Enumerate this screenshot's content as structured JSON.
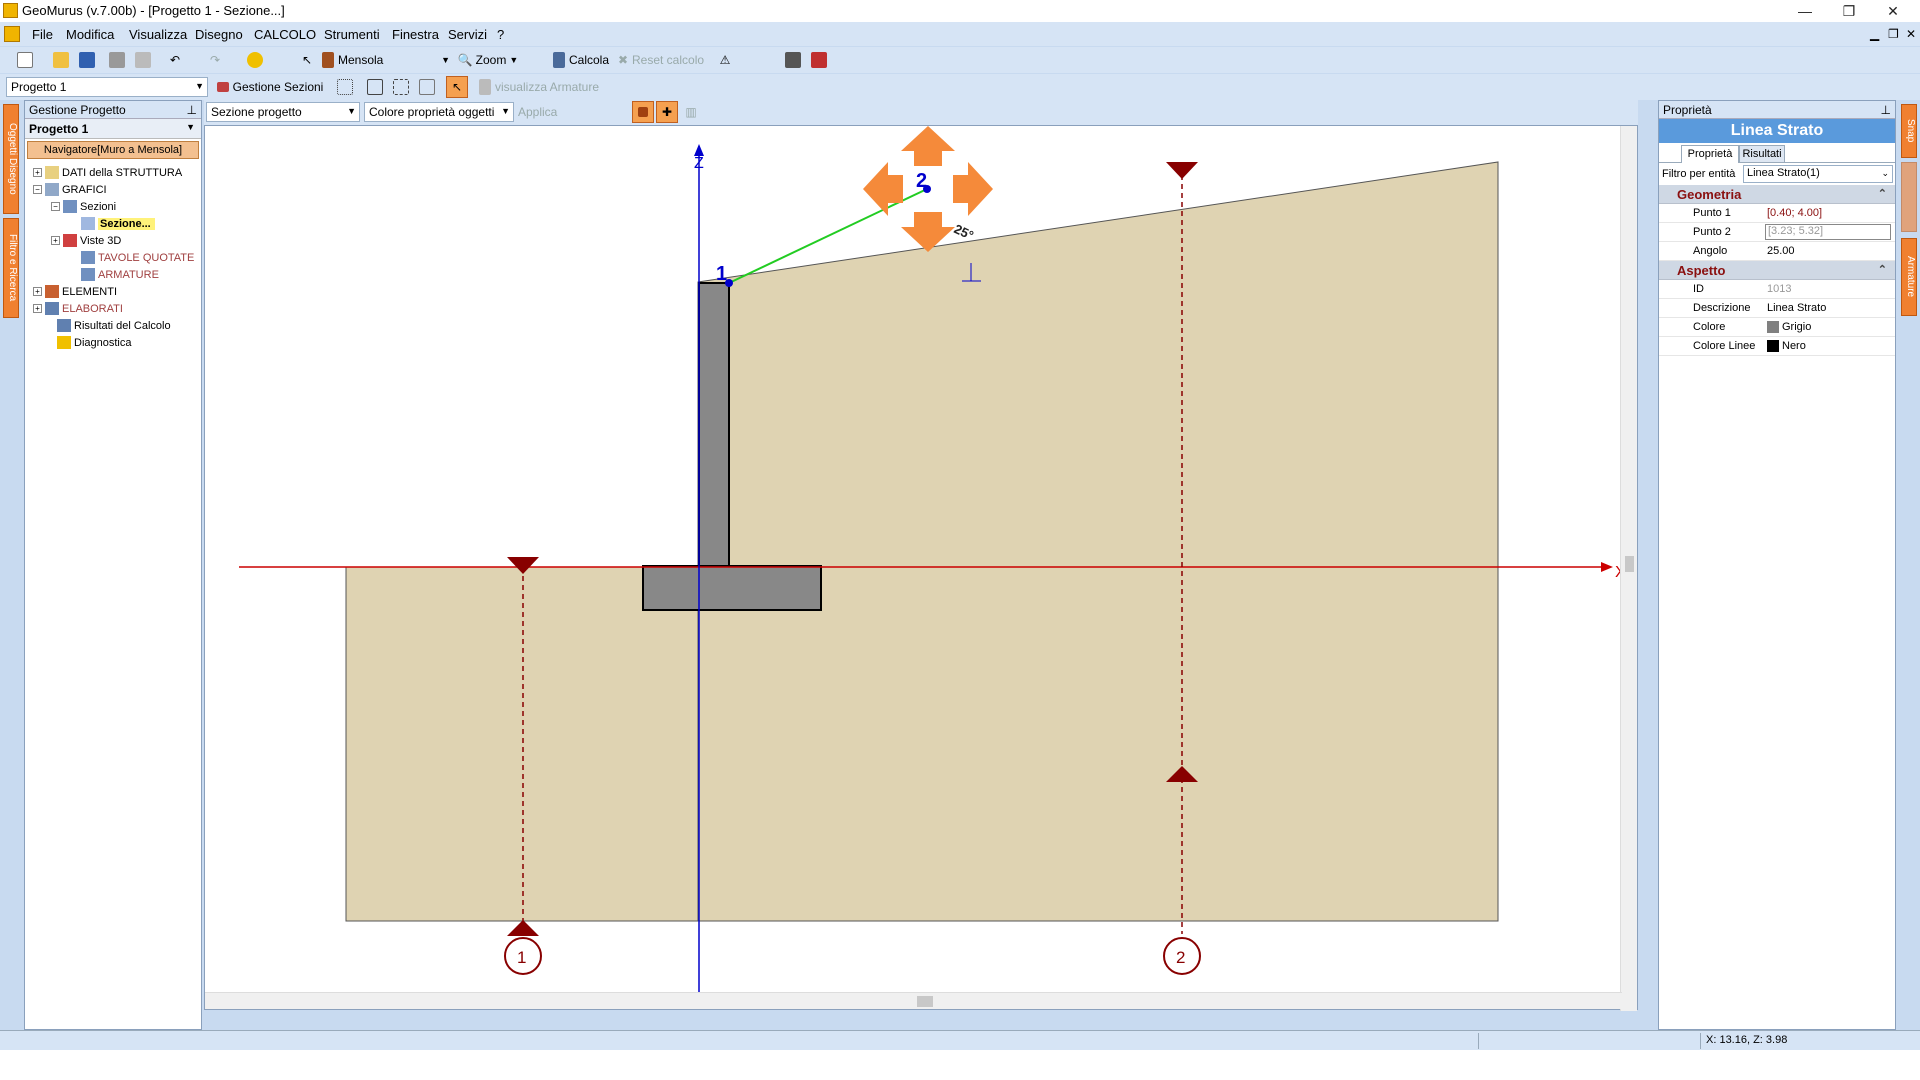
{
  "window": {
    "title": "GeoMurus (v.7.00b) - [Progetto 1 - Sezione...]"
  },
  "menu": [
    "File",
    "Modifica",
    "Visualizza",
    "Disegno",
    "CALCOLO",
    "Strumenti",
    "Finestra",
    "Servizi",
    "?"
  ],
  "toolbar1": {
    "wall_type": "Mensola",
    "zoom": "Zoom",
    "calc": "Calcola",
    "reset": "Reset calcolo"
  },
  "toolbar2": {
    "project": "Progetto 1",
    "sections": "Gestione Sezioni",
    "show_rebar": "visualizza Armature"
  },
  "toolbar3": {
    "section_mode": "Sezione progetto",
    "color_mode": "Colore proprietà oggetti",
    "apply": "Applica"
  },
  "left_panel": {
    "title": "Gestione Progetto",
    "project": "Progetto 1",
    "navigator": "Navigatore[Muro a Mensola]",
    "tree": [
      {
        "label": "DATI della STRUTTURA",
        "expander": "+",
        "color": "#000000"
      },
      {
        "label": "GRAFICI",
        "expander": "−",
        "color": "#000000"
      },
      {
        "label": "Sezioni",
        "expander": "−",
        "color": "#000000"
      },
      {
        "label": "Sezione...",
        "expander": "",
        "color": "#000000"
      },
      {
        "label": "Viste 3D",
        "expander": "+",
        "color": "#000000"
      },
      {
        "label": "TAVOLE QUOTATE",
        "expander": "",
        "color": "#a04040"
      },
      {
        "label": "ARMATURE",
        "expander": "",
        "color": "#a04040"
      },
      {
        "label": "ELEMENTI",
        "expander": "+",
        "color": "#000000"
      },
      {
        "label": "ELABORATI",
        "expander": "+",
        "color": "#a04040"
      },
      {
        "label": "Risultati del Calcolo",
        "expander": "",
        "color": "#000000"
      },
      {
        "label": "Diagnostica",
        "expander": "",
        "color": "#000000"
      }
    ]
  },
  "left_strip": [
    "Oggetti Disegno",
    "Filtro e Ricerca"
  ],
  "right_strip": [
    "Snap",
    "Armature"
  ],
  "canvas": {
    "axis_z": "Z",
    "axis_x": "X",
    "point1": "1",
    "point2": "2",
    "angle_label": "25°",
    "section_markers": [
      "1",
      "2"
    ]
  },
  "right_panel": {
    "title": "Proprietà",
    "entity": "Linea Strato",
    "tabs": [
      "Proprietà",
      "Risultati"
    ],
    "filter_label": "Filtro per entità",
    "filter_value": "Linea Strato(1)",
    "groups": [
      {
        "name": "Geometria",
        "rows": [
          {
            "key": "Punto 1",
            "value": "[0.40; 4.00]"
          },
          {
            "key": "Punto 2",
            "value": "[3.23; 5.32]"
          },
          {
            "key": "Angolo",
            "value": "25.00"
          }
        ]
      },
      {
        "name": "Aspetto",
        "rows": [
          {
            "key": "ID",
            "value": "1013"
          },
          {
            "key": "Descrizione",
            "value": "Linea Strato"
          },
          {
            "key": "Colore",
            "value": "Grigio",
            "swatch": "#808080"
          },
          {
            "key": "Colore Linee",
            "value": "Nero",
            "swatch": "#000000"
          }
        ]
      }
    ]
  },
  "status": {
    "coords": "X: 13.16, Z: 3.98"
  },
  "colors": {
    "soil": "#dfd3b2",
    "wall": "#888888",
    "axis_x": "#cc0000",
    "axis_z": "#0000cc",
    "strato": "#22cc22",
    "marker": "#880000",
    "handle": "#f58a3a"
  }
}
